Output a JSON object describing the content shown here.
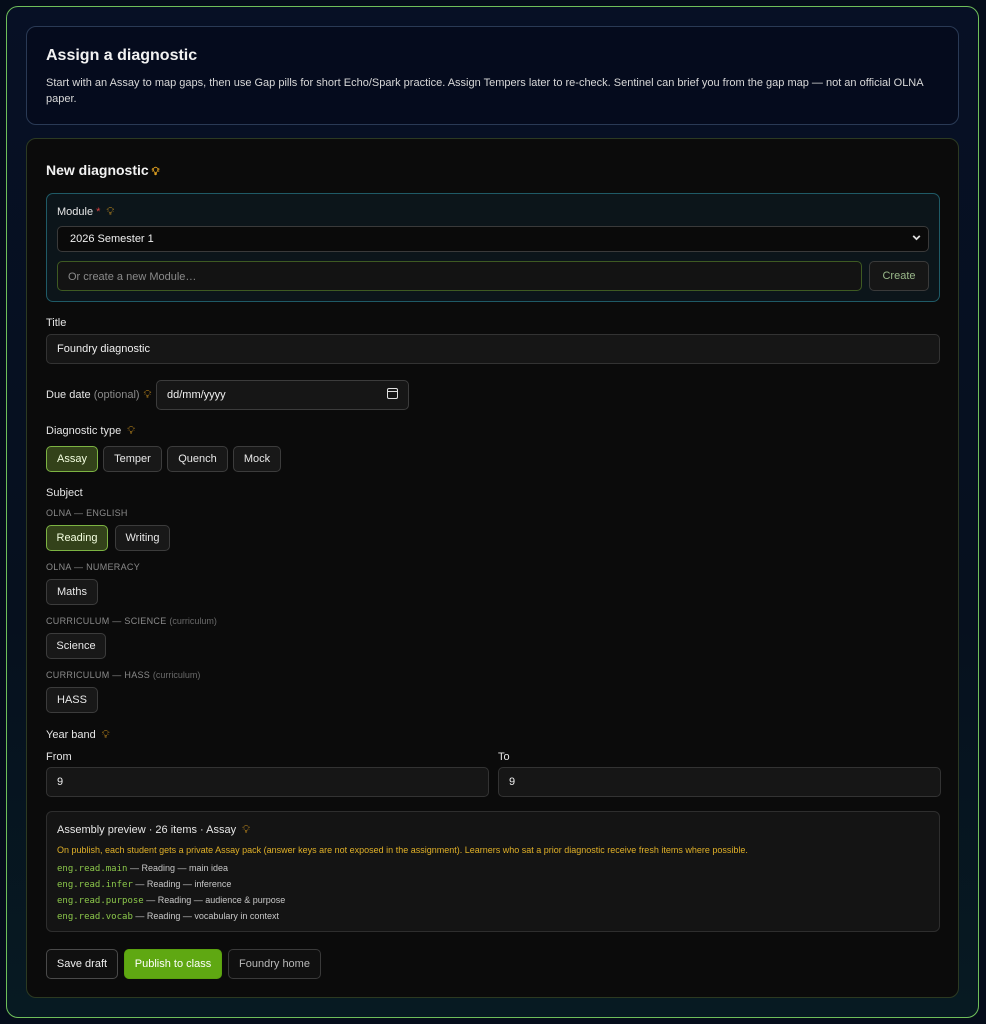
{
  "header": {
    "title": "Assign a diagnostic",
    "description": "Start with an Assay to map gaps, then use Gap pills for short Echo/Spark practice. Assign Tempers later to re-check. Sentinel can brief you from the gap map — not an official OLNA paper."
  },
  "form": {
    "title": "New diagnostic",
    "module": {
      "label": "Module",
      "required_mark": "*",
      "selected": "2026 Semester 1",
      "new_placeholder": "Or create a new Module…",
      "create_label": "Create"
    },
    "title_field": {
      "label": "Title",
      "value": "Foundry diagnostic"
    },
    "due_date": {
      "label": "Due date",
      "optional": "(optional)",
      "placeholder": "dd/mm/yyyy"
    },
    "diagnostic_type": {
      "label": "Diagnostic type",
      "options": [
        "Assay",
        "Temper",
        "Quench",
        "Mock"
      ],
      "selected": "Assay"
    },
    "subject": {
      "label": "Subject",
      "groups": [
        {
          "caption": "OLNA — ENGLISH",
          "suffix": "",
          "options": [
            "Reading",
            "Writing"
          ]
        },
        {
          "caption": "OLNA — NUMERACY",
          "suffix": "",
          "options": [
            "Maths"
          ]
        },
        {
          "caption": "CURRICULUM — SCIENCE",
          "suffix": "(curriculum)",
          "options": [
            "Science"
          ]
        },
        {
          "caption": "CURRICULUM — HASS",
          "suffix": "(curriculum)",
          "options": [
            "HASS"
          ]
        }
      ],
      "selected": "Reading"
    },
    "year_band": {
      "label": "Year band",
      "from_label": "From",
      "from_value": "9",
      "to_label": "To",
      "to_value": "9"
    },
    "preview": {
      "heading": "Assembly preview · 26 items · Assay",
      "notice": "On publish, each student gets a private Assay pack (answer keys are not exposed in the assignment). Learners who sat a prior diagnostic receive fresh items where possible.",
      "items": [
        {
          "code": "eng.read.main",
          "desc": "— Reading — main idea"
        },
        {
          "code": "eng.read.infer",
          "desc": "— Reading — inference"
        },
        {
          "code": "eng.read.purpose",
          "desc": "— Reading — audience & purpose"
        },
        {
          "code": "eng.read.vocab",
          "desc": "— Reading — vocabulary in context"
        }
      ]
    },
    "actions": {
      "save_draft": "Save draft",
      "publish": "Publish to class",
      "home": "Foundry home"
    }
  },
  "colors": {
    "accent": "#5fa812",
    "active_chip": "#33421a",
    "hint_icon": "#e0a020"
  }
}
